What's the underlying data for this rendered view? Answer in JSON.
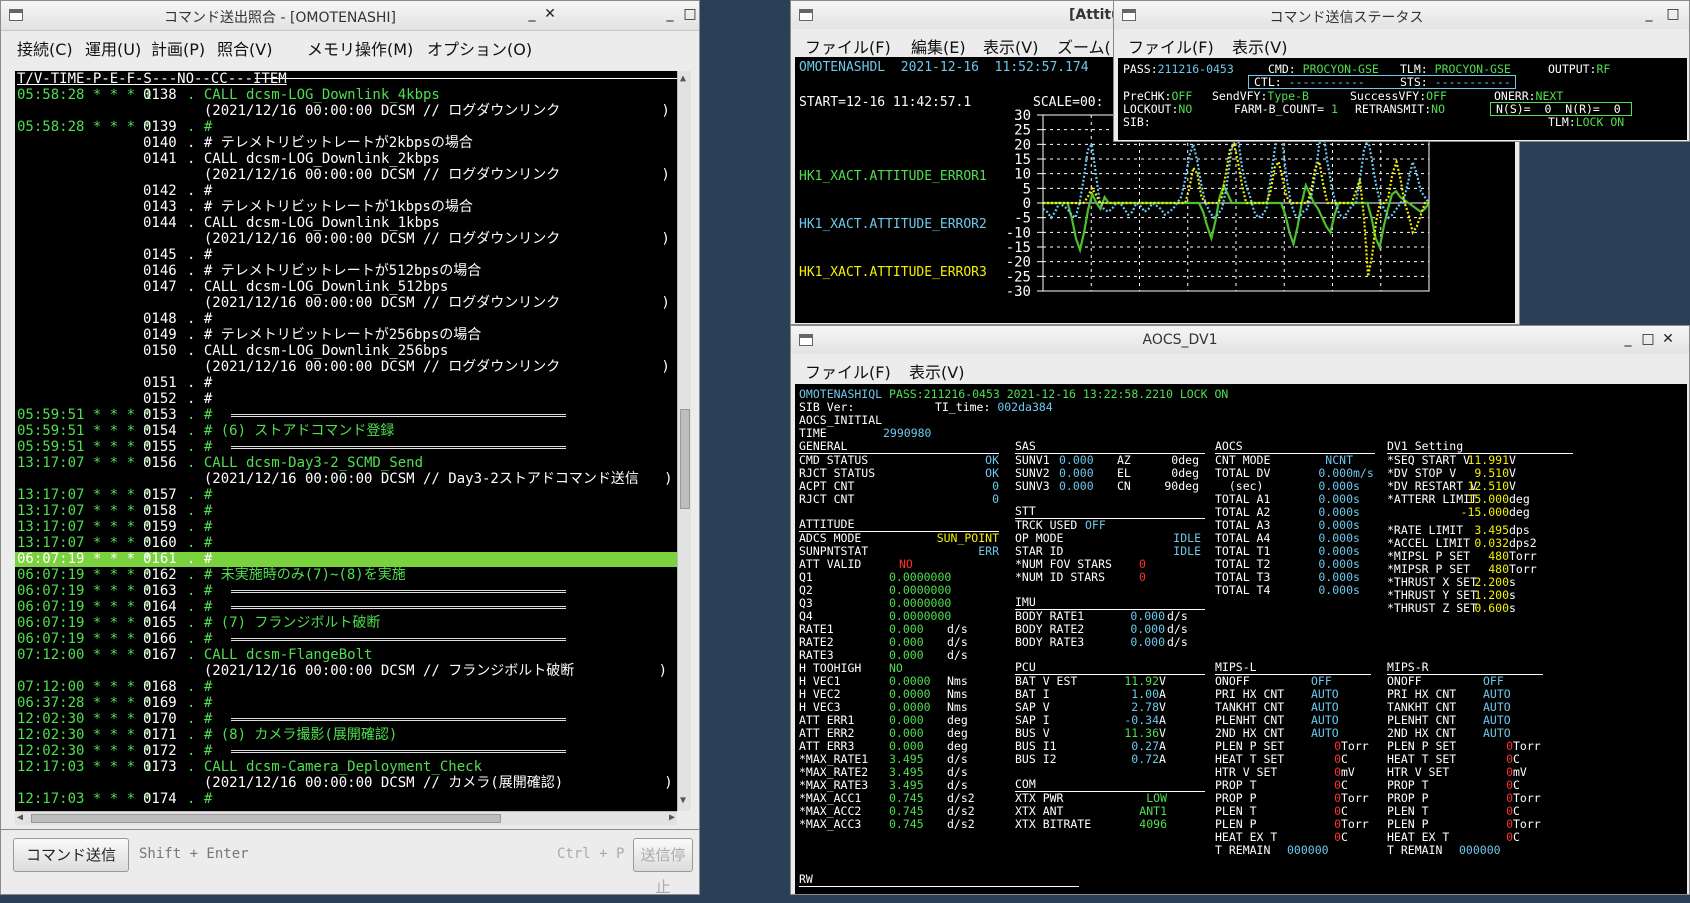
{
  "cmd_window": {
    "title": "コマンド送出照合 - [OMOTENASHI]",
    "menu": [
      "接続(C)",
      "運用(U)",
      "計画(P)",
      "照合(V)",
      "メモリ操作(M)",
      "オプション(O)"
    ],
    "header": "T/V-TIME-P-E-F-S---NO--CC---ITEM",
    "rows": [
      [
        "05:58:28 * * * 1",
        "0138",
        ". CALL dcsm-LOG_Downlink_4kbps",
        ""
      ],
      [
        "",
        "",
        "  (2021/12/16 00:00:00 DCSM // ログダウンリンク            )",
        ""
      ],
      [
        "05:58:28 * * * *",
        "0139",
        ". #",
        ""
      ],
      [
        "",
        "0140",
        ". # テレメトリビットレートが2kbpsの場合",
        ""
      ],
      [
        "",
        "0141",
        ". CALL dcsm-LOG_Downlink_2kbps",
        ""
      ],
      [
        "",
        "",
        "  (2021/12/16 00:00:00 DCSM // ログダウンリンク            )",
        ""
      ],
      [
        "",
        "0142",
        ". #",
        ""
      ],
      [
        "",
        "0143",
        ". # テレメトリビットレートが1kbpsの場合",
        ""
      ],
      [
        "",
        "0144",
        ". CALL dcsm-LOG_Downlink_1kbps",
        ""
      ],
      [
        "",
        "",
        "  (2021/12/16 00:00:00 DCSM // ログダウンリンク            )",
        ""
      ],
      [
        "",
        "0145",
        ". #",
        ""
      ],
      [
        "",
        "0146",
        ". # テレメトリビットレートが512bpsの場合",
        ""
      ],
      [
        "",
        "0147",
        ". CALL dcsm-LOG_Downlink_512bps",
        ""
      ],
      [
        "",
        "",
        "  (2021/12/16 00:00:00 DCSM // ログダウンリンク            )",
        ""
      ],
      [
        "",
        "0148",
        ". #",
        ""
      ],
      [
        "",
        "0149",
        ". # テレメトリビットレートが256bpsの場合",
        ""
      ],
      [
        "",
        "0150",
        ". CALL dcsm-LOG_Downlink_256bps",
        ""
      ],
      [
        "",
        "",
        "  (2021/12/16 00:00:00 DCSM // ログダウンリンク            )",
        ""
      ],
      [
        "",
        "0151",
        ". #",
        ""
      ],
      [
        "",
        "0152",
        ". #",
        ""
      ],
      [
        "05:59:51 * * * *",
        "0153",
        ". #",
        "sep"
      ],
      [
        "05:59:51 * * * *",
        "0154",
        ". # (6) ストアドコマンド登録",
        ""
      ],
      [
        "05:59:51 * * * *",
        "0155",
        ". #",
        "sep"
      ],
      [
        "13:17:07 * * * *",
        "0156",
        ". CALL dcsm-Day3-2_SCMD_Send",
        ""
      ],
      [
        "",
        "",
        "  (2021/12/16 00:00:00 DCSM // Day3-2ストアドコマンド送信   )",
        ""
      ],
      [
        "13:17:07 * * * *",
        "0157",
        ". #",
        ""
      ],
      [
        "13:17:07 * * * *",
        "0158",
        ". #",
        ""
      ],
      [
        "13:17:07 * * * *",
        "0159",
        ". #",
        ""
      ],
      [
        "13:17:07 * * * *",
        "0160",
        ". #",
        ""
      ],
      [
        "06:07:19 * * * *",
        "0161",
        ". #",
        "hl"
      ],
      [
        "06:07:19 * * * *",
        "0162",
        ". # 未実施時のみ(7)~(8)を実施",
        ""
      ],
      [
        "06:07:19 * * * *",
        "0163",
        ". #",
        "sep"
      ],
      [
        "06:07:19 * * * *",
        "0164",
        ". #",
        "sep"
      ],
      [
        "06:07:19 * * * *",
        "0165",
        ". # (7) フランジボルト破断",
        ""
      ],
      [
        "06:07:19 * * * *",
        "0166",
        ". #",
        "sep"
      ],
      [
        "07:12:00 * * * *",
        "0167",
        ". CALL dcsm-FlangeBolt",
        ""
      ],
      [
        "",
        "",
        "  (2021/12/16 00:00:00 DCSM // フランジボルト破断          )",
        ""
      ],
      [
        "07:12:00 * * * *",
        "0168",
        ". #",
        ""
      ],
      [
        "06:37:28 * * * *",
        "0169",
        ". #",
        ""
      ],
      [
        "12:02:30 * * * *",
        "0170",
        ". #",
        "sep"
      ],
      [
        "12:02:30 * * * *",
        "0171",
        ". # (8) カメラ撮影(展開確認)",
        ""
      ],
      [
        "12:02:30 * * * *",
        "0172",
        ". #",
        "sep"
      ],
      [
        "12:17:03 * * * 1",
        "0173",
        ". CALL dcsm-Camera_Deployment_Check",
        ""
      ],
      [
        "",
        "",
        "  (2021/12/16 00:00:00 DCSM // カメラ(展開確認)            )",
        ""
      ],
      [
        "12:17:03 * * * *",
        "0174",
        ". #",
        ""
      ]
    ],
    "send_button": "コマンド送信",
    "send_hint": "Shift + Enter",
    "stop_hint": "Ctrl + P",
    "stop_button": "送信停止"
  },
  "graph_window": {
    "title": "[Attitu",
    "menu": [
      "ファイル(F)",
      "編集(E)",
      "表示(V)",
      "ズーム("
    ],
    "header": "OMOTENASHDL  2021-12-16  11:52:57.174",
    "start": "START=12-16 11:42:57.1",
    "scale": "SCALE=00:",
    "labels": [
      "HK1_XACT.ATTITUDE_ERROR1",
      "HK1_XACT.ATTITUDE_ERROR2",
      "HK1_XACT.ATTITUDE_ERROR3"
    ],
    "ticks": [
      "30",
      "25",
      "20",
      "15",
      "10",
      "5",
      "0",
      "-5",
      "-10",
      "-15",
      "-20",
      "-25",
      "-30"
    ]
  },
  "chart_data": {
    "type": "line",
    "ylim": [
      -30,
      30
    ],
    "series": [
      {
        "name": "HK1_XACT.ATTITUDE_ERROR1",
        "color": "#4fbf2f",
        "values": [
          0,
          0,
          0,
          0,
          0,
          0,
          0,
          -5,
          -12,
          -16,
          -10,
          -2,
          3,
          0,
          -2,
          2,
          0,
          0,
          0,
          0,
          0,
          0,
          0,
          0,
          0,
          0,
          0,
          0,
          0,
          0,
          0,
          0,
          0,
          0,
          0,
          0,
          0,
          0,
          0,
          -3,
          -8,
          -12,
          -6,
          2,
          6,
          3,
          0,
          0,
          0,
          0,
          0,
          0,
          0,
          0,
          0,
          0,
          0,
          0,
          0,
          -4,
          -10,
          -14,
          -8,
          0,
          6,
          3,
          0,
          -2,
          -5,
          -8,
          -10,
          -4,
          0,
          0,
          0,
          0,
          0,
          0,
          0,
          0,
          -5,
          -12,
          -15,
          -8,
          -2,
          3,
          4,
          2,
          1,
          0,
          -1,
          -2,
          -3,
          -2,
          0
        ]
      },
      {
        "name": "HK1_XACT.ATTITUDE_ERROR2",
        "color": "#6cc8ec",
        "values": [
          -2,
          -3,
          -5,
          -3,
          0,
          -1,
          -2,
          -4,
          -5,
          0,
          8,
          18,
          20,
          10,
          0,
          -2,
          -3,
          -2,
          0,
          0,
          -2,
          -4,
          -3,
          0,
          -1,
          -3,
          -2,
          0,
          -1,
          -2,
          -4,
          -3,
          -2,
          0,
          2,
          8,
          16,
          20,
          14,
          6,
          0,
          -3,
          -5,
          -4,
          -2,
          4,
          14,
          24,
          22,
          12,
          6,
          2,
          -3,
          -5,
          -4,
          -2,
          8,
          18,
          26,
          20,
          8,
          0,
          -4,
          -5,
          -3,
          -2,
          2,
          10,
          20,
          24,
          14,
          6,
          0,
          -4,
          -5,
          -3,
          -1,
          0,
          8,
          18,
          22,
          14,
          6,
          0,
          -2,
          -5,
          -4,
          -2,
          0,
          2,
          8,
          14,
          10,
          4,
          2,
          0
        ]
      },
      {
        "name": "HK1_XACT.ATTITUDE_ERROR3",
        "color": "#f4f000",
        "values": [
          0,
          0,
          0,
          0,
          0,
          0,
          0,
          0,
          0,
          0,
          0,
          2,
          5,
          3,
          0,
          0,
          0,
          0,
          0,
          0,
          0,
          0,
          0,
          0,
          0,
          0,
          0,
          0,
          0,
          0,
          0,
          0,
          0,
          0,
          0,
          0,
          5,
          12,
          10,
          2,
          0,
          0,
          0,
          0,
          2,
          10,
          18,
          20,
          14,
          6,
          0,
          0,
          0,
          0,
          0,
          0,
          4,
          12,
          14,
          8,
          2,
          0,
          0,
          0,
          0,
          0,
          4,
          12,
          14,
          6,
          0,
          0,
          0,
          0,
          0,
          0,
          0,
          4,
          8,
          -5,
          -25,
          -18,
          -6,
          0,
          0,
          2,
          10,
          14,
          8,
          0,
          -4,
          -10,
          -8,
          -4,
          0,
          0
        ]
      }
    ]
  },
  "status_window": {
    "title": "コマンド送信ステータス",
    "menu": [
      "ファイル(F)",
      "表示(V)"
    ],
    "pass_l": "PASS:",
    "pass_v": "211216-0453",
    "cmd_l": "CMD:",
    "cmd_v": "PROCYON-GSE",
    "tlm_l": "TLM:",
    "tlm_v": "PROCYON-GSE",
    "out_l": "OUTPUT:",
    "out_v": "RF",
    "ctl_l": "CTL:",
    "ctl_v": "-----------",
    "sts_l": "STS:",
    "sts_v": "-----------",
    "prechk_l": "PreCHK:",
    "prechk_v": "OFF",
    "sendvfy_l": "SendVFY:",
    "sendvfy_v": "Type-B",
    "successvfy_l": "SuccessVFY:",
    "successvfy_v": "OFF",
    "onerr_l": "ONERR:",
    "onerr_v": "NEXT",
    "lockout_l": "LOCKOUT:",
    "lockout_v": "NO",
    "farm_l": "FARM-B_COUNT=",
    "farm_v": "1",
    "retransmit_l": "RETRANSMIT:",
    "retransmit_v": "NO",
    "ns": "N(S)=  0  N(R)=  0",
    "sib_l": "SIB:",
    "tlm2_l": "TLM:",
    "tlm2_v": "LOCK ON"
  },
  "aocs_window": {
    "title": "AOCS_DV1",
    "menu": [
      "ファイル(F)",
      "表示(V)"
    ],
    "hdr_name": "OMOTENASHIQL",
    "hdr_rest": "PASS:211216-0453 2021-12-16 13:22:58.2210 LOCK ON",
    "sib": "SIB Ver:",
    "ti_l": "TI_time:",
    "ti_v": "002da384",
    "initial": "AOCS_INITIAL",
    "time_l": "TIME",
    "time_v": "2990980",
    "sec_general": "GENERAL",
    "sec_attitude": "ATTITUDE",
    "sec_sas": "SAS",
    "sec_stt": "STT",
    "sec_imu": "IMU",
    "sec_pcu": "PCU",
    "sec_com": "COM",
    "sec_aocs": "AOCS",
    "sec_dv1": "DV1 Setting",
    "sec_mipsl": "MIPS-L",
    "sec_mipsr": "MIPS-R",
    "sec_rw": "RW",
    "general": [
      [
        "CMD STATUS",
        "OK"
      ],
      [
        "RJCT STATUS",
        "OK"
      ],
      [
        "ACPT CNT",
        "0"
      ],
      [
        "RJCT CNT",
        "0"
      ]
    ],
    "att1": [
      [
        "ADCS MODE",
        "SUN_POINT",
        "y"
      ],
      [
        "SUNPNTSTAT",
        "ERR",
        "c"
      ],
      [
        "ATT VALID",
        "NO",
        "r"
      ]
    ],
    "att2": [
      [
        "Q1",
        "0.0000000",
        ""
      ],
      [
        "Q2",
        "0.0000000",
        ""
      ],
      [
        "Q3",
        "0.0000000",
        ""
      ],
      [
        "Q4",
        "0.0000000",
        ""
      ],
      [
        "RATE1",
        "0.000",
        "d/s"
      ],
      [
        "RATE2",
        "0.000",
        "d/s"
      ],
      [
        "RATE3",
        "0.000",
        "d/s"
      ],
      [
        "H TOOHIGH",
        "NO",
        ""
      ],
      [
        "H VEC1",
        "0.0000",
        "Nms"
      ],
      [
        "H VEC2",
        "0.0000",
        "Nms"
      ],
      [
        "H VEC3",
        "0.0000",
        "Nms"
      ],
      [
        "ATT ERR1",
        "0.000",
        "deg"
      ],
      [
        "ATT ERR2",
        "0.000",
        "deg"
      ],
      [
        "ATT ERR3",
        "0.000",
        "deg"
      ],
      [
        "*MAX_RATE1",
        "3.495",
        "d/s"
      ],
      [
        "*MAX_RATE2",
        "3.495",
        "d/s"
      ],
      [
        "*MAX_RATE3",
        "3.495",
        "d/s"
      ],
      [
        "*MAX_ACC1",
        "0.745",
        "d/s2"
      ],
      [
        "*MAX_ACC2",
        "0.745",
        "d/s2"
      ],
      [
        "*MAX_ACC3",
        "0.745",
        "d/s2"
      ]
    ],
    "sas": [
      [
        "SUNV1",
        "0.000",
        "AZ",
        "0deg"
      ],
      [
        "SUNV2",
        "0.000",
        "EL",
        "0deg"
      ],
      [
        "SUNV3",
        "0.000",
        "CN",
        "90deg"
      ]
    ],
    "stt": [
      [
        "TRCK USED",
        "OFF",
        "c"
      ],
      [
        "OP MODE",
        "IDLE",
        "c"
      ],
      [
        "STAR ID",
        "IDLE",
        "c"
      ],
      [
        "*NUM FOV STARS",
        "0",
        "r"
      ],
      [
        "*NUM ID STARS",
        "0",
        "r"
      ]
    ],
    "imu": [
      [
        "BODY RATE1",
        "0.000",
        "d/s"
      ],
      [
        "BODY RATE2",
        "0.000",
        "d/s"
      ],
      [
        "BODY RATE3",
        "0.000",
        "d/s"
      ]
    ],
    "pcu": [
      [
        "BAT V EST",
        "11.92",
        "V",
        "g"
      ],
      [
        "BAT I",
        "1.00",
        "A",
        "c"
      ],
      [
        "SAP V",
        "2.78",
        "V",
        "c"
      ],
      [
        "SAP I",
        "-0.34",
        "A",
        "c"
      ],
      [
        "BUS V",
        "11.36",
        "V",
        "g"
      ],
      [
        "BUS I1",
        "0.27",
        "A",
        "c"
      ],
      [
        "BUS I2",
        "0.72",
        "A",
        "c"
      ]
    ],
    "com": [
      [
        "XTX PWR",
        "LOW"
      ],
      [
        "XTX ANT",
        "ANT1"
      ],
      [
        "XTX BITRATE",
        "4096"
      ]
    ],
    "aocs": [
      [
        "CNT MODE",
        "NCNT",
        ""
      ],
      [
        "TOTAL DV",
        "0.000",
        "m/s"
      ],
      [
        "  (sec)",
        "0.000",
        "s"
      ],
      [
        "TOTAL A1",
        "0.000",
        "s"
      ],
      [
        "TOTAL A2",
        "0.000",
        "s"
      ],
      [
        "TOTAL A3",
        "0.000",
        "s"
      ],
      [
        "TOTAL A4",
        "0.000",
        "s"
      ],
      [
        "TOTAL T1",
        "0.000",
        "s"
      ],
      [
        "TOTAL T2",
        "0.000",
        "s"
      ],
      [
        "TOTAL T3",
        "0.000",
        "s"
      ],
      [
        "TOTAL T4",
        "0.000",
        "s"
      ]
    ],
    "dv1": [
      [
        "*SEQ START V",
        "11.991",
        "V"
      ],
      [
        "*DV STOP V",
        "9.510",
        "V"
      ],
      [
        "*DV RESTART V",
        "12.510",
        "V"
      ],
      [
        "*ATTERR LIMIT",
        "15.000",
        "deg"
      ],
      [
        "",
        "-15.000",
        "deg"
      ],
      [
        "*RATE LIMIT",
        "3.495",
        "dps"
      ],
      [
        "*ACCEL LIMIT",
        "0.032",
        "dps2"
      ],
      [
        "*MIPSL P SET",
        "480",
        "Torr"
      ],
      [
        "*MIPSR P SET",
        "480",
        "Torr"
      ],
      [
        "*THRUST X SET",
        "2.200",
        "s"
      ],
      [
        "*THRUST Y SET",
        "1.200",
        "s"
      ],
      [
        "*THRUST Z SET",
        "0.600",
        "s"
      ]
    ],
    "mips": [
      [
        "ONOFF",
        "OFF",
        ""
      ],
      [
        "PRI HX CNT",
        "AUTO",
        ""
      ],
      [
        "TANKHT CNT",
        "AUTO",
        ""
      ],
      [
        "PLENHT CNT",
        "AUTO",
        ""
      ],
      [
        "2ND HX CNT",
        "AUTO",
        ""
      ],
      [
        "PLEN P SET",
        "0",
        "Torr"
      ],
      [
        "HEAT T SET",
        "0",
        "C"
      ],
      [
        "HTR V SET",
        "0",
        "mV"
      ],
      [
        "PROP T",
        "0",
        "C"
      ],
      [
        "PROP P",
        "0",
        "Torr"
      ],
      [
        "PLEN T",
        "0",
        "C"
      ],
      [
        "PLEN P",
        "0",
        "Torr"
      ],
      [
        "HEAT EX T",
        "0",
        "C"
      ],
      [
        "T REMAIN",
        "000000",
        ""
      ]
    ]
  }
}
